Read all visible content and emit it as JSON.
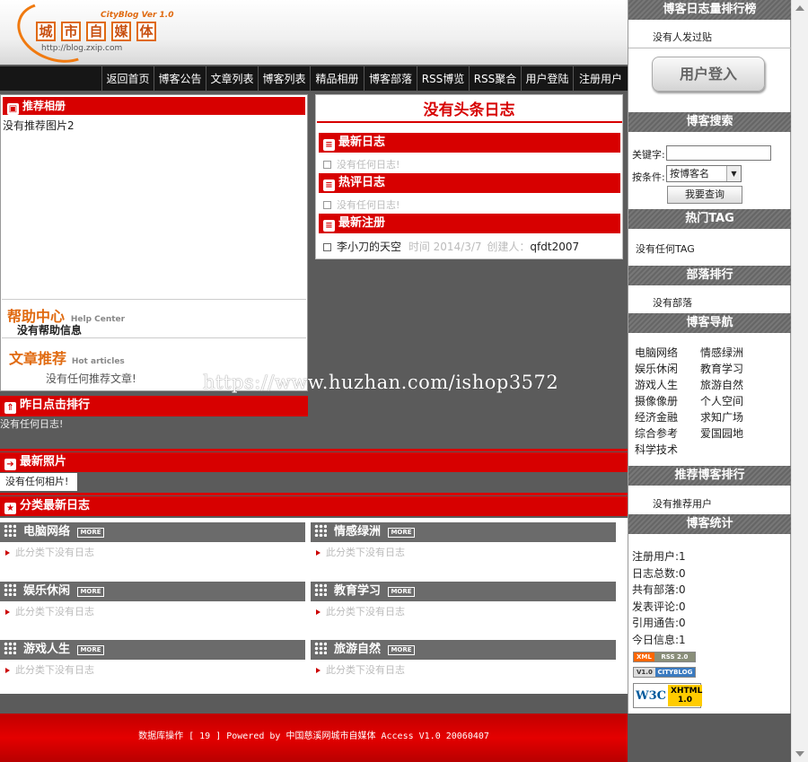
{
  "header": {
    "logo_chars": [
      "城",
      "市",
      "自",
      "媒",
      "体"
    ],
    "logo_version": "CityBlog Ver 1.0",
    "logo_url": "http://blog.zxip.com"
  },
  "nav": [
    "返回首页",
    "博客公告",
    "文章列表",
    "博客列表",
    "精品相册",
    "博客部落",
    "RSS博览",
    "RSS聚合",
    "用户登陆",
    "注册用户"
  ],
  "album": {
    "title": "推荐相册",
    "content": "没有推荐图片2"
  },
  "help": {
    "title_cn": "帮助中心",
    "title_en": "Help Center",
    "content": "没有帮助信息"
  },
  "articles": {
    "title_cn": "文章推荐",
    "title_en": "Hot articles",
    "content": "没有任何推荐文章!"
  },
  "headline": "没有头条日志",
  "latest_logs": {
    "title": "最新日志",
    "content": "没有任何日志!"
  },
  "hot_logs": {
    "title": "热评日志",
    "content": "没有任何日志!"
  },
  "latest_reg": {
    "title": "最新注册",
    "name": "李小刀的天空",
    "time_label": "时间 2014/3/7",
    "creator_label": "创建人：",
    "creator": "qfdt2007"
  },
  "watermark": "https://www.huzhan.com/ishop3572",
  "yesterday": {
    "title": "昨日点击排行",
    "content": "没有任何日志!"
  },
  "photos": {
    "title": "最新照片",
    "content": "没有任何相片!"
  },
  "category_logs": {
    "title": "分类最新日志",
    "more_label": "MORE",
    "empty_text": "此分类下没有日志",
    "categories": [
      "电脑网络",
      "情感绿洲",
      "娱乐休闲",
      "教育学习",
      "游戏人生",
      "旅游自然"
    ]
  },
  "footer": "数据库操作 [ 19 ] Powered by 中国慈溪网城市自媒体 Access V1.0 20060407",
  "right": {
    "ranking": {
      "title": "博客日志量排行榜",
      "content": "没有人发过贴"
    },
    "login_button": "用户登入",
    "search": {
      "title": "博客搜索",
      "keyword_label": "关键字:",
      "keyword_value": "",
      "condition_label": "按条件:",
      "condition_value": "按博客名",
      "submit": "我要查询"
    },
    "tags": {
      "title": "热门TAG",
      "content": "没有任何TAG"
    },
    "tribe": {
      "title": "部落排行",
      "content": "没有部落"
    },
    "blognav": {
      "title": "博客导航",
      "links": [
        "电脑网络",
        "情感绿洲",
        "娱乐休闲",
        "教育学习",
        "游戏人生",
        "旅游自然",
        "摄像像册",
        "个人空间",
        "经济金融",
        "求知广场",
        "综合参考",
        "爱国园地",
        "科学技术"
      ]
    },
    "recommend": {
      "title": "推荐博客排行",
      "content": "没有推荐用户"
    },
    "stats": {
      "title": "博客统计",
      "lines": [
        "注册用户:1",
        "日志总数:0",
        "共有部落:0",
        "发表评论:0",
        "引用通告:0",
        "今日信息:1"
      ],
      "badges": [
        "XML",
        "RSS 2.0",
        "V1.0",
        "CITYBLOG",
        "W3C",
        "XHTML 1.0"
      ]
    }
  },
  "colors": {
    "accent_red": "#d70000",
    "nav_bg": "#161616",
    "panel_gray": "#6b6b6b",
    "logo_orange": "#e06a10"
  }
}
